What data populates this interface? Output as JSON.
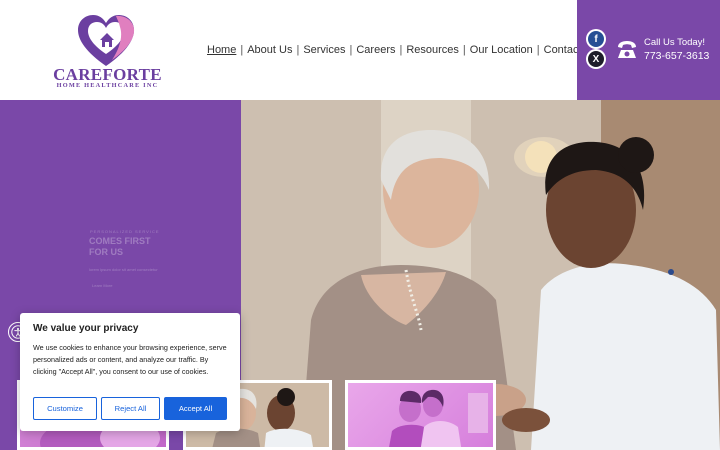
{
  "logo": {
    "wordmark": "CAREFORTE",
    "subtitle": "HOME HEALTHCARE INC"
  },
  "nav": {
    "items": [
      {
        "label": "Home",
        "active": true
      },
      {
        "label": "About Us"
      },
      {
        "label": "Services"
      },
      {
        "label": "Careers"
      },
      {
        "label": "Resources"
      },
      {
        "label": "Our Location"
      },
      {
        "label": "Contact Us"
      }
    ],
    "separator": "|"
  },
  "contact": {
    "call_label": "Call Us Today!",
    "phone": "773-657-3613",
    "social": [
      {
        "icon": "facebook-icon",
        "glyph": "f"
      },
      {
        "icon": "x-twitter-icon",
        "glyph": "X"
      }
    ]
  },
  "hero": {
    "faint_kicker": "PERSONALIZED SERVICE",
    "faint_heading": "COMES FIRST FOR US",
    "faint_paragraph": "lorem ipsum dolor sit amet consectetur",
    "faint_link": "Learn More"
  },
  "cookie": {
    "title": "We value your privacy",
    "text": "We use cookies to enhance your browsing experience, serve personalized ads or content, and analyze our traffic. By clicking \"Accept All\", you consent to our use of cookies.",
    "customize": "Customize",
    "reject": "Reject All",
    "accept": "Accept All"
  },
  "colors": {
    "brand_purple": "#7a48a8",
    "cookie_blue": "#1863dc"
  }
}
